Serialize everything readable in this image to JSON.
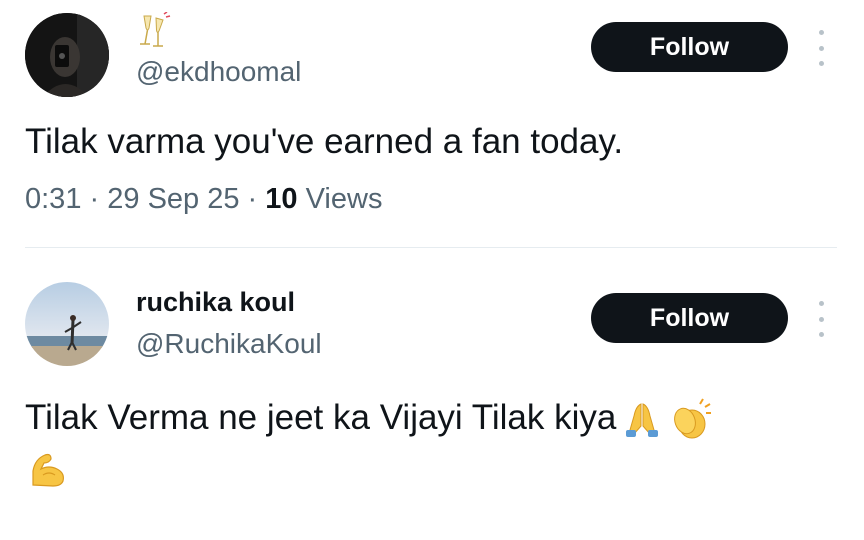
{
  "posts": [
    {
      "display_name_icon": "champagne-emoji",
      "handle": "@ekdhoomal",
      "follow_label": "Follow",
      "text": "Tilak varma you've earned a fan today.",
      "time": "0:31",
      "separator": "·",
      "date": "29 Sep 25",
      "views_count": "10",
      "views_label": "Views"
    },
    {
      "display_name": "ruchika koul",
      "handle": "@RuchikaKoul",
      "follow_label": "Follow",
      "text": "Tilak Verma ne jeet ka Vijayi Tilak kiya",
      "emojis": [
        "folded-hands-emoji",
        "clapping-hands-emoji",
        "flexed-biceps-emoji"
      ]
    }
  ],
  "colors": {
    "text_primary": "#0f1419",
    "text_secondary": "#536471",
    "follow_button_bg": "#0f1419",
    "follow_button_text": "#ffffff",
    "divider": "#e6ecf0"
  }
}
